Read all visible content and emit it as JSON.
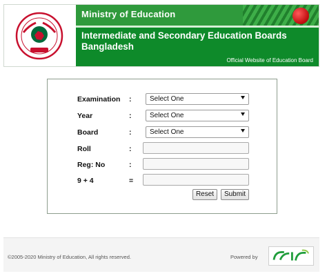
{
  "header": {
    "ministry": "Ministry of Education",
    "board_title": "Intermediate and Secondary Education Boards Bangladesh",
    "official": "Official Website of Education Board"
  },
  "form": {
    "rows": [
      {
        "label": "Examination",
        "colon": ":",
        "value": "Select One"
      },
      {
        "label": "Year",
        "colon": ":",
        "value": "Select One"
      },
      {
        "label": "Board",
        "colon": ":",
        "value": "Select One"
      },
      {
        "label": "Roll",
        "colon": ":",
        "value": ""
      },
      {
        "label": "Reg: No",
        "colon": ":",
        "value": ""
      },
      {
        "label": "9 + 4",
        "colon": "=",
        "value": ""
      }
    ],
    "reset_label": "Reset",
    "submit_label": "Submit"
  },
  "footer": {
    "copyright": "©2005-2020 Ministry of Education, All rights reserved.",
    "powered": "Powered by"
  },
  "colors": {
    "banner_green": "#0e8a2a",
    "emblem_red": "#c8102e",
    "emblem_green": "#006a3a"
  }
}
